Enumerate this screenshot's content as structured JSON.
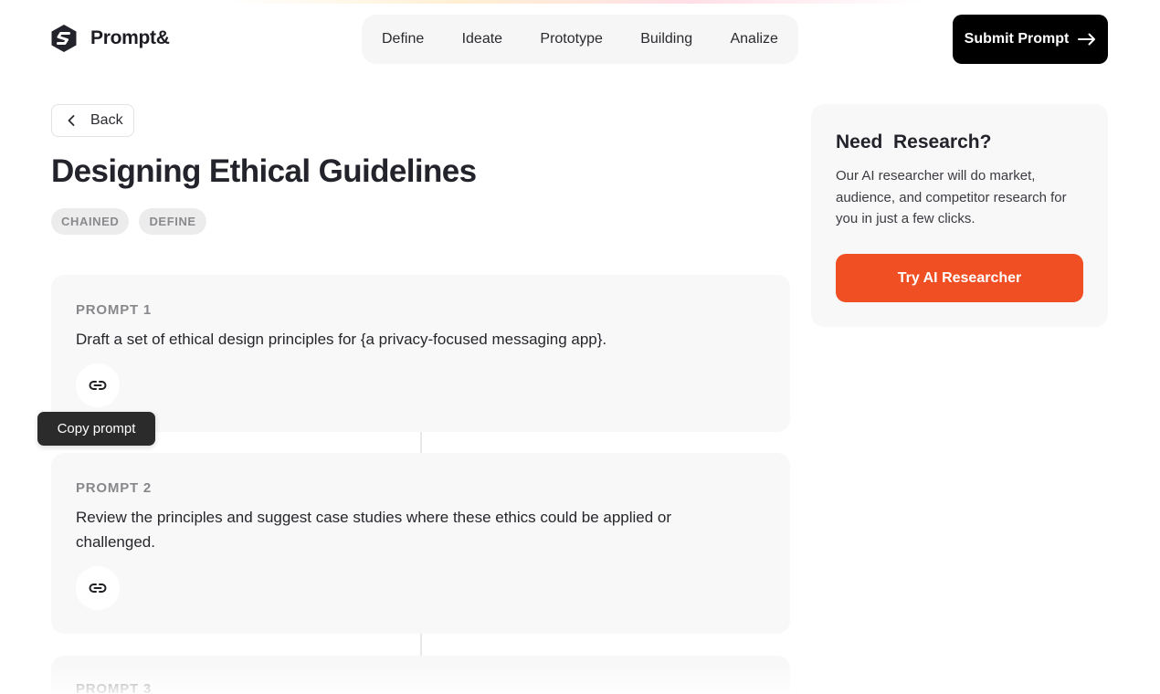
{
  "header": {
    "logo_text": "Prompt&",
    "nav": [
      "Define",
      "Ideate",
      "Prototype",
      "Building",
      "Analize"
    ],
    "submit_label": "Submit Prompt"
  },
  "main": {
    "back_label": "Back",
    "title": "Designing Ethical Guidelines",
    "tags": [
      "CHAINED",
      "DEFINE"
    ],
    "prompts": [
      {
        "label": "PROMPT 1",
        "text": "Draft a set of ethical design principles for {a privacy-focused messaging app}."
      },
      {
        "label": "PROMPT 2",
        "text": "Review the principles and suggest case studies where these ethics could be applied or challenged."
      },
      {
        "label": "PROMPT 3",
        "text": ""
      }
    ],
    "tooltip": "Copy prompt"
  },
  "research": {
    "title": "Need  Research?",
    "description": "Our AI researcher will do market, audience, and competitor research for you in just a few clicks.",
    "button_label": "Try AI Researcher"
  },
  "colors": {
    "accent": "#f04e23",
    "primary_button": "#000000",
    "card_background": "#f8f8f8"
  },
  "icons": {
    "logo": "hexagon-s-logo-icon",
    "submit": "arrow-right-icon",
    "back": "chevron-left-icon",
    "copy": "link-icon"
  }
}
